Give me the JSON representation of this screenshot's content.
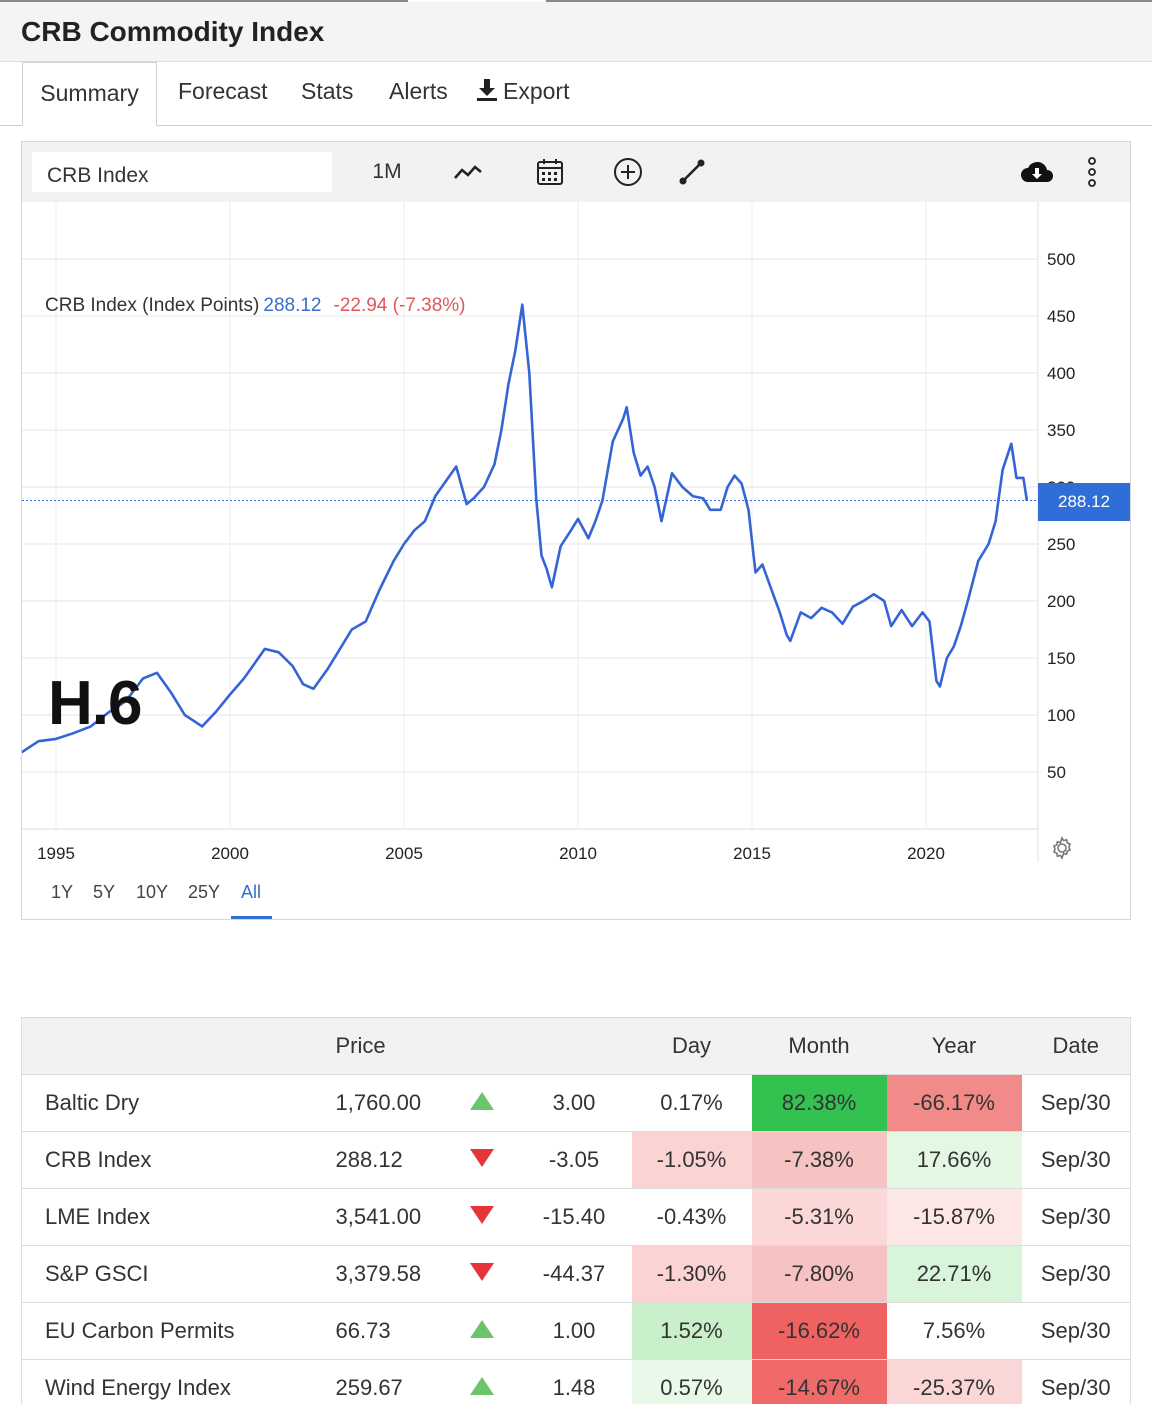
{
  "page": {
    "title": "CRB Commodity Index"
  },
  "tabs": [
    {
      "label": "Summary",
      "active": true
    },
    {
      "label": "Forecast"
    },
    {
      "label": "Stats"
    },
    {
      "label": "Alerts"
    },
    {
      "label": "Export",
      "icon": "download-icon"
    }
  ],
  "toolbar": {
    "symbol": "CRB Index",
    "period": "1M",
    "icons": [
      "line-chart-icon",
      "calendar-icon",
      "add-circle-icon",
      "draw-line-icon",
      "cloud-download-icon",
      "more-vertical-icon"
    ]
  },
  "legend": {
    "name": "CRB Index (Index Points)",
    "value": "288.12",
    "change": "-22.94 (-7.38%)"
  },
  "last_badge": "288.12",
  "watermark": "H.6",
  "ranges": [
    {
      "label": "1Y"
    },
    {
      "label": "5Y"
    },
    {
      "label": "10Y"
    },
    {
      "label": "25Y"
    },
    {
      "label": "All",
      "active": true
    }
  ],
  "colors": {
    "line": "#3564d6",
    "accent": "#2f6ed6",
    "negative": "#e0575b",
    "positive_arrow": "#6cc46a",
    "negative_arrow": "#e53538"
  },
  "chart_data": {
    "type": "line",
    "title": "CRB Index (Index Points)",
    "xlabel": "",
    "ylabel": "",
    "xlim": [
      1994.0,
      2023.3
    ],
    "ylim": [
      0,
      500
    ],
    "x_ticks": [
      "1995",
      "2000",
      "2005",
      "2010",
      "2015",
      "2020"
    ],
    "y_ticks": [
      "50",
      "100",
      "150",
      "200",
      "250",
      "300",
      "350",
      "400",
      "450",
      "500"
    ],
    "grid": true,
    "last_value": 288.12,
    "series": [
      {
        "name": "CRB Index",
        "points": [
          [
            1994.0,
            67
          ],
          [
            1994.5,
            77
          ],
          [
            1995.0,
            79
          ],
          [
            1995.5,
            84
          ],
          [
            1996.0,
            90
          ],
          [
            1996.5,
            102
          ],
          [
            1997.0,
            112
          ],
          [
            1997.5,
            132
          ],
          [
            1997.9,
            137
          ],
          [
            1998.3,
            120
          ],
          [
            1998.7,
            100
          ],
          [
            1999.2,
            90
          ],
          [
            1999.6,
            103
          ],
          [
            2000.0,
            118
          ],
          [
            2000.4,
            132
          ],
          [
            2000.7,
            145
          ],
          [
            2001.0,
            158
          ],
          [
            2001.4,
            155
          ],
          [
            2001.8,
            143
          ],
          [
            2002.1,
            127
          ],
          [
            2002.4,
            123
          ],
          [
            2002.8,
            140
          ],
          [
            2003.1,
            155
          ],
          [
            2003.5,
            175
          ],
          [
            2003.9,
            182
          ],
          [
            2004.3,
            210
          ],
          [
            2004.7,
            235
          ],
          [
            2005.0,
            250
          ],
          [
            2005.3,
            262
          ],
          [
            2005.6,
            270
          ],
          [
            2005.9,
            292
          ],
          [
            2006.2,
            305
          ],
          [
            2006.5,
            318
          ],
          [
            2006.8,
            285
          ],
          [
            2007.0,
            290
          ],
          [
            2007.3,
            300
          ],
          [
            2007.6,
            320
          ],
          [
            2007.8,
            350
          ],
          [
            2008.0,
            390
          ],
          [
            2008.2,
            420
          ],
          [
            2008.4,
            460
          ],
          [
            2008.6,
            400
          ],
          [
            2008.8,
            290
          ],
          [
            2008.95,
            240
          ],
          [
            2009.1,
            228
          ],
          [
            2009.25,
            212
          ],
          [
            2009.5,
            248
          ],
          [
            2009.8,
            262
          ],
          [
            2010.0,
            272
          ],
          [
            2010.3,
            255
          ],
          [
            2010.5,
            270
          ],
          [
            2010.7,
            288
          ],
          [
            2011.0,
            340
          ],
          [
            2011.3,
            360
          ],
          [
            2011.4,
            370
          ],
          [
            2011.6,
            330
          ],
          [
            2011.8,
            310
          ],
          [
            2012.0,
            318
          ],
          [
            2012.2,
            300
          ],
          [
            2012.4,
            270
          ],
          [
            2012.7,
            312
          ],
          [
            2013.0,
            300
          ],
          [
            2013.3,
            292
          ],
          [
            2013.6,
            290
          ],
          [
            2013.8,
            280
          ],
          [
            2014.1,
            280
          ],
          [
            2014.3,
            300
          ],
          [
            2014.5,
            310
          ],
          [
            2014.7,
            303
          ],
          [
            2014.9,
            280
          ],
          [
            2015.1,
            225
          ],
          [
            2015.3,
            232
          ],
          [
            2015.5,
            215
          ],
          [
            2015.8,
            190
          ],
          [
            2016.0,
            170
          ],
          [
            2016.1,
            165
          ],
          [
            2016.4,
            190
          ],
          [
            2016.7,
            185
          ],
          [
            2017.0,
            194
          ],
          [
            2017.3,
            190
          ],
          [
            2017.6,
            180
          ],
          [
            2017.9,
            195
          ],
          [
            2018.2,
            200
          ],
          [
            2018.5,
            206
          ],
          [
            2018.8,
            200
          ],
          [
            2019.0,
            178
          ],
          [
            2019.3,
            192
          ],
          [
            2019.6,
            178
          ],
          [
            2019.9,
            190
          ],
          [
            2020.1,
            182
          ],
          [
            2020.3,
            130
          ],
          [
            2020.4,
            125
          ],
          [
            2020.6,
            150
          ],
          [
            2020.8,
            160
          ],
          [
            2021.0,
            178
          ],
          [
            2021.2,
            200
          ],
          [
            2021.5,
            235
          ],
          [
            2021.8,
            250
          ],
          [
            2022.0,
            270
          ],
          [
            2022.2,
            315
          ],
          [
            2022.45,
            338
          ],
          [
            2022.6,
            308
          ],
          [
            2022.8,
            308
          ],
          [
            2022.9,
            288
          ]
        ]
      }
    ]
  },
  "quotes": {
    "columns": [
      "",
      "Price",
      "",
      "",
      "Day",
      "Month",
      "Year",
      "Date"
    ],
    "rows": [
      {
        "name": "Baltic Dry",
        "price": "1,760.00",
        "dir": "up",
        "change": "3.00",
        "day": "0.17%",
        "month": "82.38%",
        "year": "-66.17%",
        "date": "Sep/30",
        "day_bg": "#ffffff",
        "month_bg": "#33c24f",
        "year_bg": "#f28a8a"
      },
      {
        "name": "CRB Index",
        "price": "288.12",
        "dir": "down",
        "change": "-3.05",
        "day": "-1.05%",
        "month": "-7.38%",
        "year": "17.66%",
        "date": "Sep/30",
        "day_bg": "#fbd3d3",
        "month_bg": "#f6c2c2",
        "year_bg": "#e3f7e3"
      },
      {
        "name": "LME Index",
        "price": "3,541.00",
        "dir": "down",
        "change": "-15.40",
        "day": "-0.43%",
        "month": "-5.31%",
        "year": "-15.87%",
        "date": "Sep/30",
        "day_bg": "#ffffff",
        "month_bg": "#fbd7d7",
        "year_bg": "#fde6e6"
      },
      {
        "name": "S&P GSCI",
        "price": "3,379.58",
        "dir": "down",
        "change": "-44.37",
        "day": "-1.30%",
        "month": "-7.80%",
        "year": "22.71%",
        "date": "Sep/30",
        "day_bg": "#fbd3d3",
        "month_bg": "#f6c2c2",
        "year_bg": "#d8f4d9"
      },
      {
        "name": "EU Carbon Permits",
        "price": "66.73",
        "dir": "up",
        "change": "1.00",
        "day": "1.52%",
        "month": "-16.62%",
        "year": "7.56%",
        "date": "Sep/30",
        "day_bg": "#c9f0cb",
        "month_bg": "#f06262",
        "year_bg": "#ffffff"
      },
      {
        "name": "Wind Energy Index",
        "price": "259.67",
        "dir": "up",
        "change": "1.48",
        "day": "0.57%",
        "month": "-14.67%",
        "year": "-25.37%",
        "date": "Sep/30",
        "day_bg": "#e8f8e9",
        "month_bg": "#f06a6a",
        "year_bg": "#fbd6d6"
      }
    ]
  }
}
